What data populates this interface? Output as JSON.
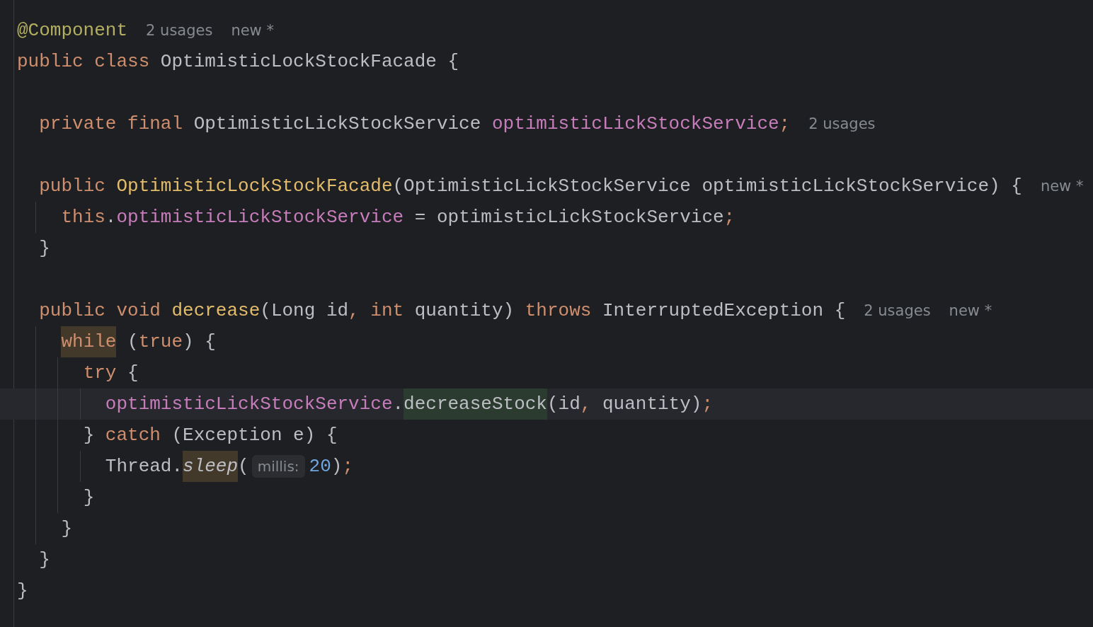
{
  "editor": {
    "lines": [
      {
        "kind": "code",
        "current": false,
        "tokens": [
          {
            "kind": "annotation",
            "text": "@Component"
          }
        ],
        "hints": [
          "2 usages",
          "new *"
        ]
      },
      {
        "kind": "code",
        "current": false,
        "tokens": [
          {
            "kind": "keyword",
            "text": "public class "
          },
          {
            "kind": "plain",
            "text": "OptimisticLockStockFacade {"
          }
        ]
      },
      {
        "kind": "blank"
      },
      {
        "kind": "code",
        "current": false,
        "tokens": [
          {
            "kind": "keyword",
            "text": "  private final "
          },
          {
            "kind": "plain",
            "text": "OptimisticLickStockService "
          },
          {
            "kind": "field",
            "text": "optimisticLickStockService"
          },
          {
            "kind": "keyword",
            "text": ";"
          }
        ],
        "hints": [
          "2 usages"
        ]
      },
      {
        "kind": "blank"
      },
      {
        "kind": "code",
        "current": false,
        "tokens": [
          {
            "kind": "keyword",
            "text": "  public "
          },
          {
            "kind": "declaration",
            "text": "OptimisticLockStockFacade"
          },
          {
            "kind": "plain",
            "text": "(OptimisticLickStockService optimisticLickStockService) {"
          }
        ],
        "hints": [
          "new *"
        ]
      },
      {
        "kind": "code",
        "current": false,
        "tokens": [
          {
            "kind": "keyword",
            "text": "    this"
          },
          {
            "kind": "plain",
            "text": "."
          },
          {
            "kind": "field",
            "text": "optimisticLickStockService"
          },
          {
            "kind": "plain",
            "text": " = optimisticLickStockService"
          },
          {
            "kind": "keyword",
            "text": ";"
          }
        ]
      },
      {
        "kind": "code",
        "current": false,
        "tokens": [
          {
            "kind": "plain",
            "text": "  }"
          }
        ]
      },
      {
        "kind": "blank"
      },
      {
        "kind": "code",
        "current": false,
        "tokens": [
          {
            "kind": "keyword",
            "text": "  public void "
          },
          {
            "kind": "declaration",
            "text": "decrease"
          },
          {
            "kind": "plain",
            "text": "(Long id"
          },
          {
            "kind": "keyword",
            "text": ", int "
          },
          {
            "kind": "plain",
            "text": "quantity) "
          },
          {
            "kind": "keyword",
            "text": "throws "
          },
          {
            "kind": "plain",
            "text": "InterruptedException {"
          }
        ],
        "hints": [
          "2 usages",
          "new *"
        ]
      },
      {
        "kind": "code",
        "current": false,
        "tokens": [
          {
            "kind": "keyword",
            "text": "    while",
            "highlighted": true,
            "color": "#43392b"
          },
          {
            "kind": "plain",
            "text": " ("
          },
          {
            "kind": "keyword",
            "text": "true"
          },
          {
            "kind": "plain",
            "text": ") {"
          }
        ]
      },
      {
        "kind": "code",
        "current": false,
        "tokens": [
          {
            "kind": "keyword",
            "text": "      try "
          },
          {
            "kind": "plain",
            "text": "{"
          }
        ]
      },
      {
        "kind": "code",
        "current": true,
        "tokens": [
          {
            "kind": "field",
            "text": "        optimisticLickStockService"
          },
          {
            "kind": "plain",
            "text": "."
          },
          {
            "kind": "plain",
            "text": "decreaseStock",
            "highlighted": true,
            "color": "#2c3b30"
          },
          {
            "kind": "plain",
            "text": "(id"
          },
          {
            "kind": "keyword",
            "text": ", "
          },
          {
            "kind": "plain",
            "text": "quantity)"
          },
          {
            "kind": "keyword",
            "text": ";"
          }
        ]
      },
      {
        "kind": "code",
        "current": false,
        "tokens": [
          {
            "kind": "plain",
            "text": "      } "
          },
          {
            "kind": "keyword",
            "text": "catch "
          },
          {
            "kind": "plain",
            "text": "(Exception e) {"
          }
        ]
      },
      {
        "kind": "code",
        "current": false,
        "tokens": [
          {
            "kind": "plain",
            "text": "        Thread."
          },
          {
            "kind": "static",
            "text": "sleep",
            "highlighted": true,
            "color": "#43392b"
          },
          {
            "kind": "plain",
            "text": "("
          },
          {
            "kind": "parameter-hint",
            "text": "millis:"
          },
          {
            "kind": "number",
            "text": "20"
          },
          {
            "kind": "plain",
            "text": ")"
          },
          {
            "kind": "keyword",
            "text": ";"
          }
        ]
      },
      {
        "kind": "code",
        "current": false,
        "tokens": [
          {
            "kind": "plain",
            "text": "      }"
          }
        ]
      },
      {
        "kind": "code",
        "current": false,
        "tokens": [
          {
            "kind": "plain",
            "text": "    }"
          }
        ]
      },
      {
        "kind": "code",
        "current": false,
        "tokens": [
          {
            "kind": "plain",
            "text": "  }"
          }
        ]
      },
      {
        "kind": "code",
        "current": false,
        "tokens": [
          {
            "kind": "plain",
            "text": "}"
          }
        ]
      }
    ]
  }
}
